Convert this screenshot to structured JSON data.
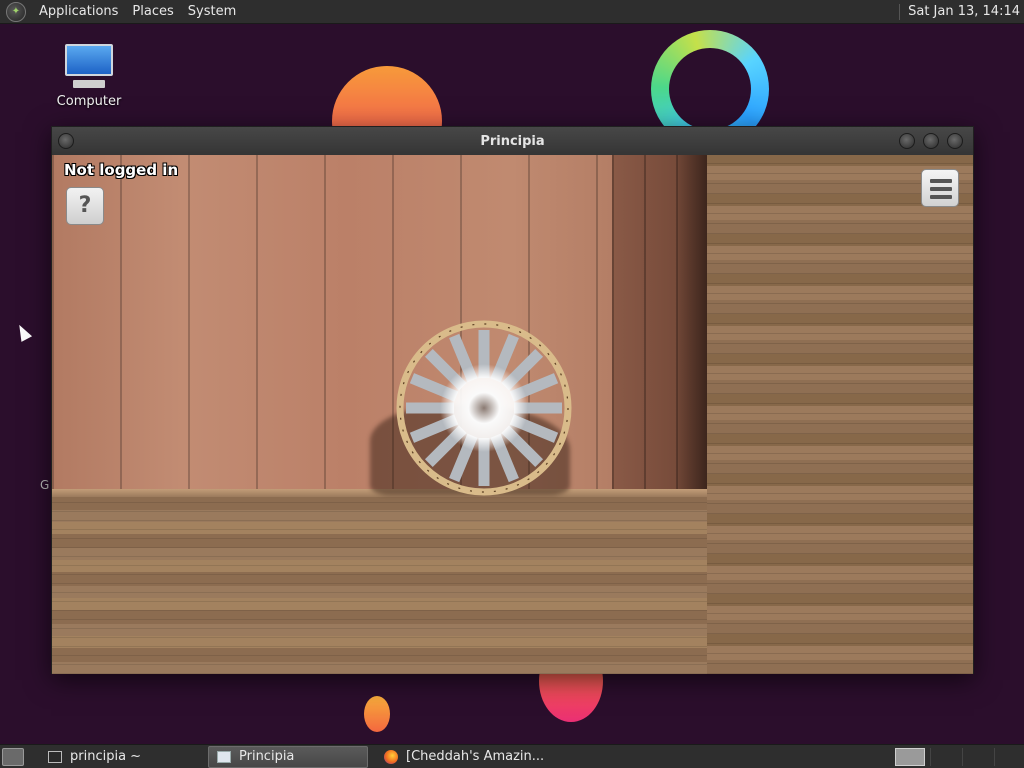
{
  "top_panel": {
    "menus": [
      "Applications",
      "Places",
      "System"
    ],
    "clock": "Sat Jan 13, 14:14"
  },
  "desktop": {
    "icons": [
      {
        "label": "Computer",
        "icon": "computer-icon"
      }
    ],
    "stray_text": "G"
  },
  "window": {
    "title": "Principia",
    "hud": {
      "status": "Not logged in",
      "help_label": "?",
      "menu_icon": "hamburger-menu-icon"
    }
  },
  "taskbar": {
    "tasks": [
      {
        "label": "principia ~",
        "icon": "terminal-icon",
        "active": false
      },
      {
        "label": "Principia",
        "icon": "window-icon",
        "active": true
      },
      {
        "label": "[Cheddah's Amazin...",
        "icon": "firefox-icon",
        "active": false
      }
    ]
  },
  "colors": {
    "wallpaper": "#2b0e2c",
    "panel": "#2e2e2e"
  }
}
